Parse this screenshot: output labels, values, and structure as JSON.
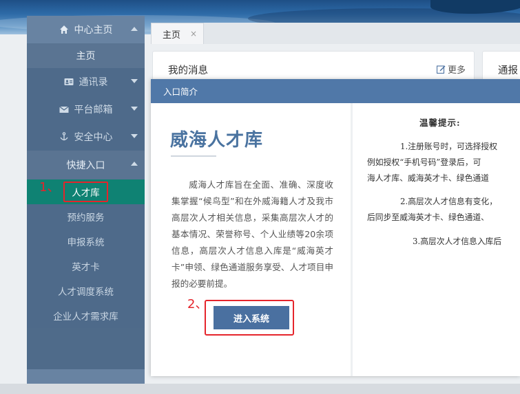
{
  "sidebar": {
    "home_header": "中心主页",
    "home_item": "主页",
    "contacts": "通讯录",
    "mail": "平台邮箱",
    "security": "安全中心",
    "quick_entry": "快捷入口",
    "items": [
      "人才库",
      "预约服务",
      "申报系统",
      "英才卡",
      "人才调度系统",
      "企业人才需求库"
    ]
  },
  "annotations": {
    "step1": "1、",
    "step2": "2、"
  },
  "tabs": {
    "home": "主页",
    "close": "×"
  },
  "cards": {
    "messages_title": "我的消息",
    "more": "更多",
    "second_title": "通报"
  },
  "modal": {
    "header": "入口简介",
    "title": "威海人才库",
    "description": "威海人才库旨在全面、准确、深度收集掌握“候鸟型”和在外威海籍人才及我市高层次人才相关信息，采集高层次人才的基本情况、荣誉称号、个人业绩等20余项信息，高层次人才信息入库是“威海英才卡”申领、绿色通道服务享受、人才项目申报的必要前提。",
    "enter_button": "进入系统",
    "tips_title": "温馨提示:",
    "tip1_lines": [
      "1.注册账号时，可选择授权",
      "例如授权“手机号码”登录后，可",
      "海人才库、威海英才卡、绿色通道"
    ],
    "tip2_lines": [
      "2.高层次人才信息有变化，",
      "后同步至威海英才卡、绿色通道、"
    ],
    "tip3_lines": [
      "3.高层次人才信息入库后"
    ]
  },
  "colors": {
    "sidebar": "#6883a2",
    "active_item": "#0f8273",
    "modal_header": "#5078a8",
    "button": "#4a70a0",
    "annotation": "#e5242b"
  }
}
